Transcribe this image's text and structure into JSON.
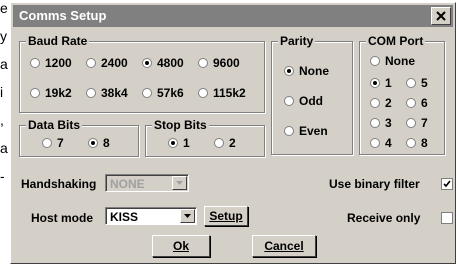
{
  "background_text": {
    "lines": [
      "e",
      "y",
      "a",
      "i",
      ",",
      "a",
      "-"
    ]
  },
  "dialog": {
    "title": "Comms Setup",
    "close_icon": "close-icon"
  },
  "baud_rate": {
    "label": "Baud Rate",
    "options": [
      {
        "label": "1200",
        "checked": false
      },
      {
        "label": "2400",
        "checked": false
      },
      {
        "label": "4800",
        "checked": true
      },
      {
        "label": "9600",
        "checked": false
      },
      {
        "label": "19k2",
        "checked": false
      },
      {
        "label": "38k4",
        "checked": false
      },
      {
        "label": "57k6",
        "checked": false
      },
      {
        "label": "115k2",
        "checked": false
      }
    ]
  },
  "parity": {
    "label": "Parity",
    "options": [
      {
        "label": "None",
        "checked": true
      },
      {
        "label": "Odd",
        "checked": false
      },
      {
        "label": "Even",
        "checked": false
      }
    ]
  },
  "com_port": {
    "label": "COM Port",
    "options": [
      {
        "label": "None",
        "checked": false
      },
      {
        "label": "1",
        "checked": true
      },
      {
        "label": "5",
        "checked": false
      },
      {
        "label": "2",
        "checked": false
      },
      {
        "label": "6",
        "checked": false
      },
      {
        "label": "3",
        "checked": false
      },
      {
        "label": "7",
        "checked": false
      },
      {
        "label": "4",
        "checked": false
      },
      {
        "label": "8",
        "checked": false
      }
    ]
  },
  "data_bits": {
    "label": "Data Bits",
    "options": [
      {
        "label": "7",
        "checked": false
      },
      {
        "label": "8",
        "checked": true
      }
    ]
  },
  "stop_bits": {
    "label": "Stop Bits",
    "options": [
      {
        "label": "1",
        "checked": true
      },
      {
        "label": "2",
        "checked": false
      }
    ]
  },
  "handshaking": {
    "label": "Handshaking",
    "value": "NONE",
    "disabled": true
  },
  "host_mode": {
    "label": "Host mode",
    "value": "KISS",
    "setup_label": "Setup"
  },
  "use_binary_filter": {
    "label": "Use binary filter",
    "checked": true
  },
  "receive_only": {
    "label": "Receive only",
    "checked": false
  },
  "buttons": {
    "ok": "Ok",
    "cancel": "Cancel"
  }
}
